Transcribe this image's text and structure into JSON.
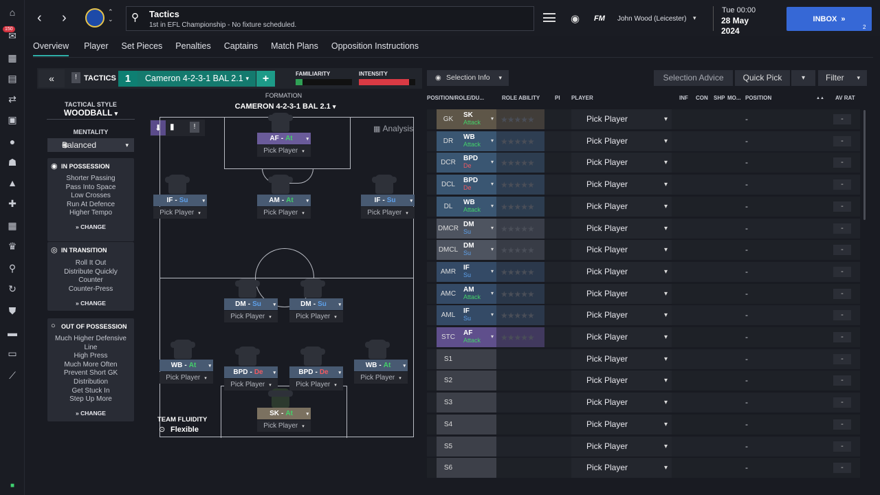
{
  "header": {
    "title": "Tactics",
    "subtitle": "1st in EFL Championship - No fixture scheduled.",
    "brand": "FM",
    "manager": "John Wood (Leicester)",
    "date_time": "Tue 00:00",
    "date_day": "28 May",
    "date_year": "2024",
    "inbox_label": "INBOX",
    "inbox_count": "2",
    "notification_badge": "150"
  },
  "subnav": [
    "Overview",
    "Player",
    "Set Pieces",
    "Penalties",
    "Captains",
    "Match Plans",
    "Opposition Instructions"
  ],
  "tactic": {
    "label": "TACTICS",
    "slot": "1",
    "name": "Cameron 4-2-3-1 BAL 2.1",
    "familiarity_label": "FAMILIARITY",
    "intensity_label": "INTENSITY",
    "familiarity": 0.12,
    "intensity": 0.89,
    "formation_label": "FORMATION",
    "formation_name": "CAMERON 4-2-3-1 BAL 2.1",
    "analysis": "Analysis",
    "team_fluidity_label": "TEAM FLUIDITY",
    "team_fluidity": "Flexible"
  },
  "side": {
    "style_label": "TACTICAL STYLE",
    "style": "WOODBALL",
    "mentality_label": "MENTALITY",
    "mentality": "Balanced",
    "change": "CHANGE",
    "in_possession": {
      "title": "IN POSSESSION",
      "items": [
        "Shorter Passing",
        "Pass Into Space",
        "Low Crosses",
        "Run At Defence",
        "Higher Tempo"
      ]
    },
    "in_transition": {
      "title": "IN TRANSITION",
      "items": [
        "Roll It Out",
        "Distribute Quickly",
        "Counter",
        "Counter-Press"
      ]
    },
    "out_of_possession": {
      "title": "OUT OF POSSESSION",
      "items": [
        "Much Higher Defensive",
        "Line",
        "High Press",
        "Much More Often",
        "Prevent Short GK",
        "Distribution",
        "Get Stuck In",
        "Step Up More"
      ]
    }
  },
  "pitch": {
    "pick": "Pick Player",
    "af": {
      "r": "AF",
      "d": "At"
    },
    "ifl": {
      "r": "IF",
      "d": "Su"
    },
    "am": {
      "r": "AM",
      "d": "At"
    },
    "ifr": {
      "r": "IF",
      "d": "Su"
    },
    "dml": {
      "r": "DM",
      "d": "Su"
    },
    "dmr": {
      "r": "DM",
      "d": "Su"
    },
    "wbl": {
      "r": "WB",
      "d": "At"
    },
    "bpdl": {
      "r": "BPD",
      "d": "De"
    },
    "bpdr": {
      "r": "BPD",
      "d": "De"
    },
    "wbr": {
      "r": "WB",
      "d": "At"
    },
    "gk": {
      "r": "SK",
      "d": "At"
    }
  },
  "toolbar": {
    "selection_info": "Selection Info",
    "selection_advice": "Selection Advice",
    "quick_pick": "Quick Pick",
    "filter": "Filter"
  },
  "table": {
    "headers": {
      "position": "POSITION/ROLE/DU...",
      "role_ability": "ROLE ABILITY",
      "pi": "PI",
      "player": "PLAYER",
      "inf": "INF",
      "con": "CON",
      "shp": "SHP",
      "mo": "MO...",
      "pos": "POSITION",
      "sort": "▲▲",
      "av": "AV RAT"
    },
    "pick": "Pick Player",
    "dash": "-",
    "rows": [
      {
        "pos": "GK",
        "role": "SK",
        "duty": "Attack"
      },
      {
        "pos": "DR",
        "role": "WB",
        "duty": "Attack"
      },
      {
        "pos": "DCR",
        "role": "BPD",
        "duty": "De"
      },
      {
        "pos": "DCL",
        "role": "BPD",
        "duty": "De"
      },
      {
        "pos": "DL",
        "role": "WB",
        "duty": "Attack"
      },
      {
        "pos": "DMCR",
        "role": "DM",
        "duty": "Su"
      },
      {
        "pos": "DMCL",
        "role": "DM",
        "duty": "Su"
      },
      {
        "pos": "AMR",
        "role": "IF",
        "duty": "Su"
      },
      {
        "pos": "AMC",
        "role": "AM",
        "duty": "Attack"
      },
      {
        "pos": "AML",
        "role": "IF",
        "duty": "Su"
      },
      {
        "pos": "STC",
        "role": "AF",
        "duty": "Attack"
      },
      {
        "pos": "S1",
        "role": "",
        "duty": ""
      },
      {
        "pos": "S2",
        "role": "",
        "duty": ""
      },
      {
        "pos": "S3",
        "role": "",
        "duty": ""
      },
      {
        "pos": "S4",
        "role": "",
        "duty": ""
      },
      {
        "pos": "S5",
        "role": "",
        "duty": ""
      },
      {
        "pos": "S6",
        "role": "",
        "duty": ""
      }
    ]
  },
  "colors": {
    "accent": "#2fb0a8",
    "inbox": "#3668d6",
    "attack": "#44d16a",
    "support": "#5ea0ea",
    "defend": "#f05a62",
    "gk_band": "#5e5648",
    "def_band": "#3a5672",
    "mid_band": "#4e5460",
    "att_band": "#344a66",
    "st_band": "#5f4f8c",
    "sub_band": "#3d4049"
  }
}
